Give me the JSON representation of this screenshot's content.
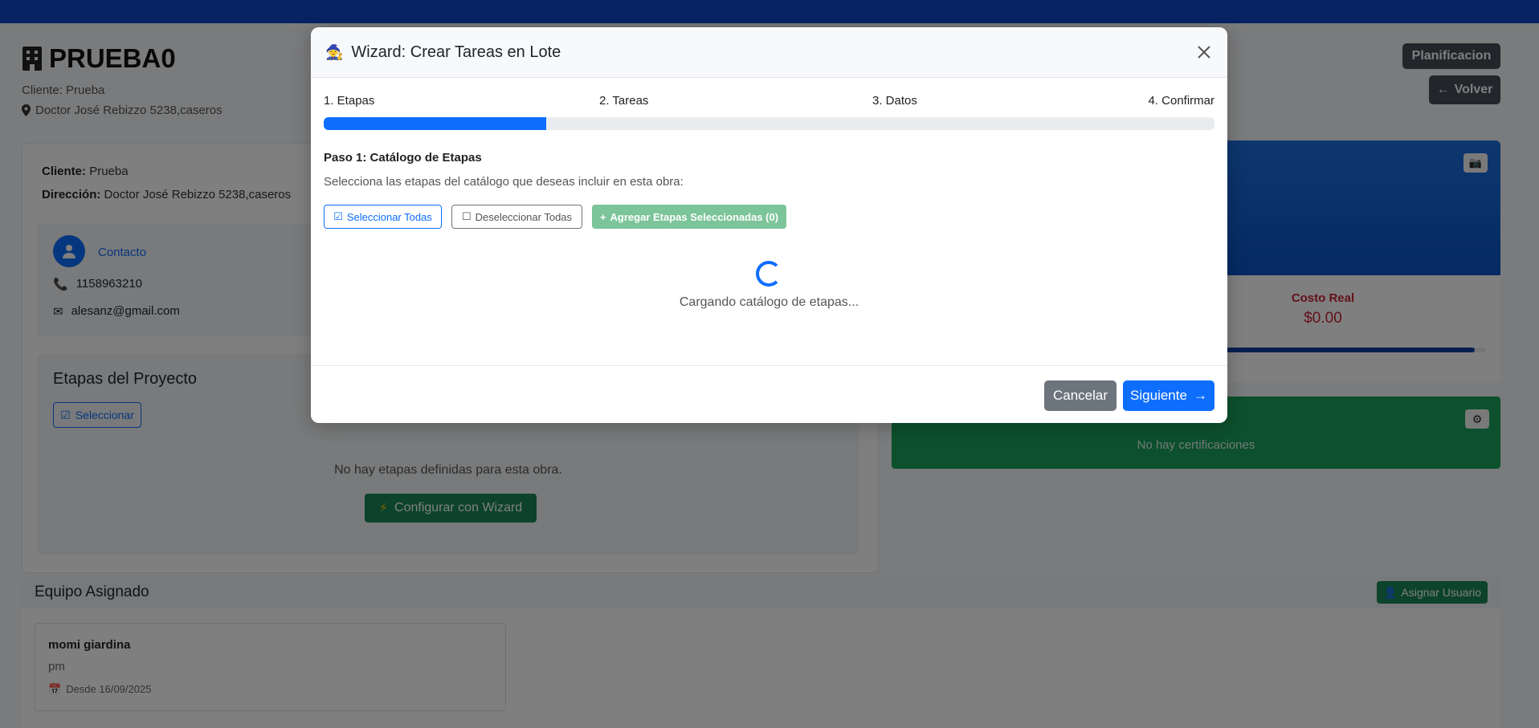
{
  "project": {
    "title": "PRUEBA0",
    "client_line": "Cliente: Prueba",
    "address_line": "Doctor José Rebizzo 5238,caseros"
  },
  "actions": {
    "planning_label": "Planificacion",
    "back_label": "Volver"
  },
  "details": {
    "client_label": "Cliente:",
    "client_value": "Prueba",
    "address_label": "Dirección:",
    "address_value": "Doctor José Rebizzo 5238,caseros"
  },
  "contact": {
    "title": "Contacto",
    "phone": "1158963210",
    "email": "alesanz@gmail.com"
  },
  "stages": {
    "title": "Etapas del Proyecto",
    "select_label": "Seleccionar",
    "empty_text": "No hay etapas definidas para esta obra.",
    "wizard_label": "Configurar con Wizard"
  },
  "costs": {
    "real_cost_label": "Costo Real",
    "real_cost_value": "$0.00"
  },
  "certifications": {
    "empty_text": "No hay certificaciones"
  },
  "team": {
    "title": "Equipo Asignado",
    "assign_label": "Asignar Usuario",
    "members": [
      {
        "name": "momi giardina",
        "role": "pm",
        "since": "Desde 16/09/2025"
      }
    ]
  },
  "modal": {
    "title": "Wizard: Crear Tareas en Lote",
    "steps": [
      "1. Etapas",
      "2. Tareas",
      "3. Datos",
      "4. Confirmar"
    ],
    "progress_fraction": 0.25,
    "step_heading": "Paso 1: Catálogo de Etapas",
    "step_description": "Selecciona las etapas del catálogo que deseas incluir en esta obra:",
    "select_all_label": "Seleccionar Todas",
    "deselect_all_label": "Deseleccionar Todas",
    "add_selected_label": "Agregar Etapas Seleccionadas (0)",
    "loading_text": "Cargando catálogo de etapas...",
    "cancel_label": "Cancelar",
    "next_label": "Siguiente"
  },
  "colors": {
    "primary": "#0d6efd",
    "success": "#198754",
    "secondary": "#6c757d",
    "danger": "#dc3545"
  }
}
